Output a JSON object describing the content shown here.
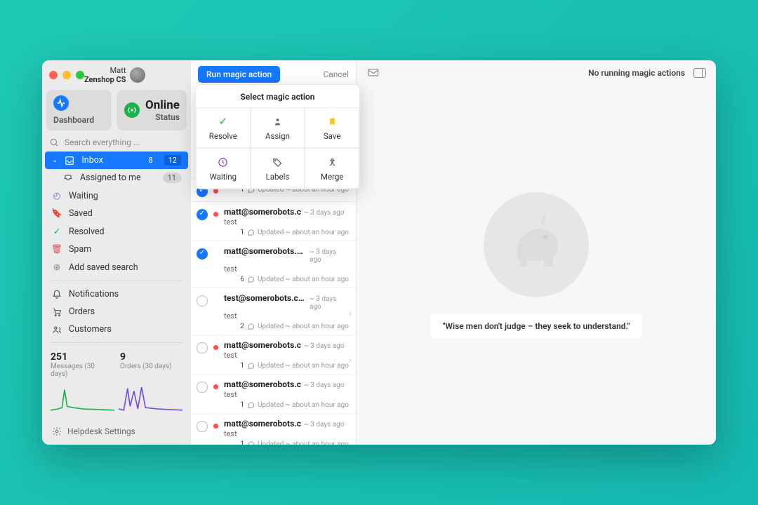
{
  "user": {
    "name": "Matt",
    "org": "Zenshop CS"
  },
  "sidebar": {
    "dashboard_label": "Dashboard",
    "status_label": "Status",
    "status_value": "Online",
    "search_placeholder": "Search everything ...",
    "nav": {
      "inbox": {
        "label": "Inbox",
        "unread": "8",
        "total": "12"
      },
      "assigned": {
        "label": "Assigned to me",
        "count": "11"
      },
      "waiting": "Waiting",
      "saved": "Saved",
      "resolved": "Resolved",
      "spam": "Spam",
      "add_saved": "Add saved search",
      "notifications": "Notifications",
      "orders": "Orders",
      "customers": "Customers"
    },
    "stats": {
      "messages_n": "251",
      "messages_l": "Messages (30 days)",
      "orders_n": "9",
      "orders_l": "Orders (30 days)"
    },
    "footer": "Helpdesk Settings"
  },
  "middle": {
    "run_label": "Run magic action",
    "cancel_label": "Cancel",
    "popover_title": "Select magic action",
    "actions": {
      "resolve": "Resolve",
      "assign": "Assign",
      "save": "Save",
      "waiting": "Waiting",
      "labels": "Labels",
      "merge": "Merge"
    },
    "threads": [
      {
        "from": "",
        "subject": "",
        "date": "",
        "count": "1",
        "meta": "Updated ~ about an hour ago",
        "selected": true,
        "tag": true,
        "truncated": true
      },
      {
        "from": "matt@somerobots.c",
        "subject": "test",
        "date": "~ 3 days ago",
        "count": "1",
        "meta": "Updated ~ about an hour ago",
        "selected": true,
        "tag": true
      },
      {
        "from": "matt@somerobots.com",
        "subject": "test",
        "date": "~ 3 days ago",
        "count": "6",
        "meta": "Updated ~ about an hour ago",
        "selected": true,
        "tag": false
      },
      {
        "from": "test@somerobots.com",
        "subject": "test",
        "date": "~ 3 days ago",
        "count": "2",
        "meta": "Updated ~ about an hour ago",
        "selected": false,
        "tag": false,
        "chev": true
      },
      {
        "from": "matt@somerobots.c",
        "subject": "test",
        "date": "~ 3 days ago",
        "count": "1",
        "meta": "Updated ~ about an hour ago",
        "selected": false,
        "tag": true,
        "chev": true
      },
      {
        "from": "matt@somerobots.c",
        "subject": "test",
        "date": "~ 3 days ago",
        "count": "1",
        "meta": "Updated ~ about an hour ago",
        "selected": false,
        "tag": true
      },
      {
        "from": "matt@somerobots.c",
        "subject": "test",
        "date": "~ 3 days ago",
        "count": "1",
        "meta": "Updated ~ about an hour ago",
        "selected": false,
        "tag": true
      }
    ]
  },
  "right": {
    "running": "No running magic actions",
    "quote": "\"Wise men don't judge – they seek to understand.\""
  }
}
